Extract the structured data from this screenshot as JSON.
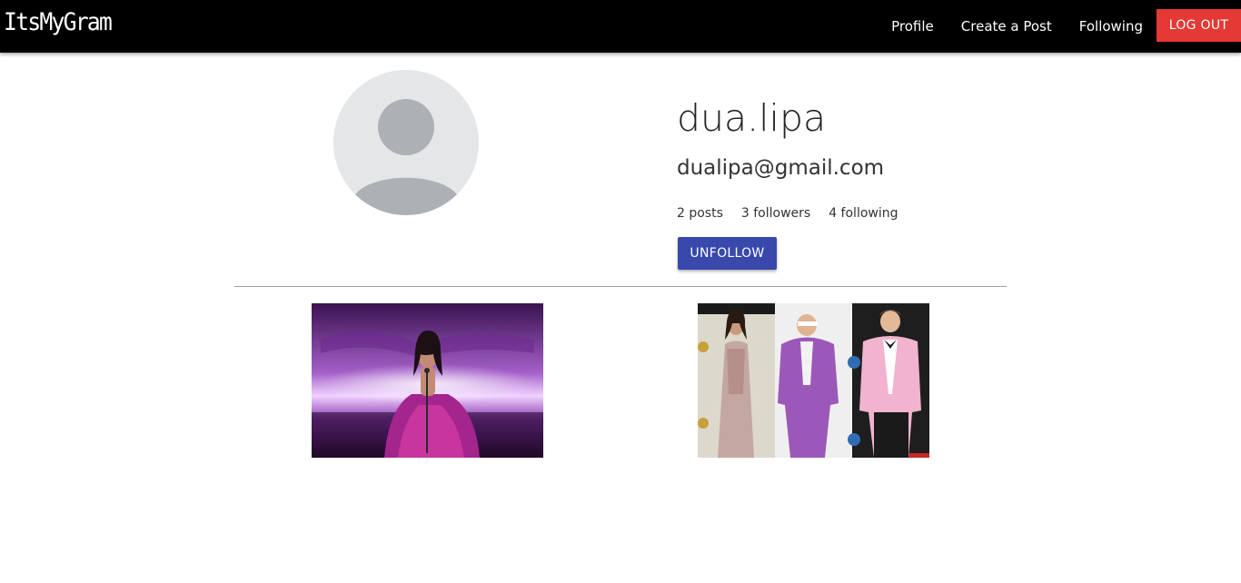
{
  "navbar": {
    "brand": "ItsMyGram",
    "links": [
      "Profile",
      "Create a Post",
      "Following"
    ],
    "logout_label": "LOG OUT"
  },
  "profile": {
    "username": "dua.lipa",
    "email": "dualipa@gmail.com",
    "posts_count": "2 posts",
    "followers_count": "3 followers",
    "following_count": "4 following",
    "unfollow_label": "UNFOLLOW"
  },
  "colors": {
    "navbar_bg": "#000000",
    "logout_bg": "#e53935",
    "unfollow_bg": "#3949ab",
    "avatar_bg": "#e4e6e8"
  },
  "posts": [
    {
      "icon": "purple-stage-photo"
    },
    {
      "icon": "red-carpet-photo"
    }
  ]
}
